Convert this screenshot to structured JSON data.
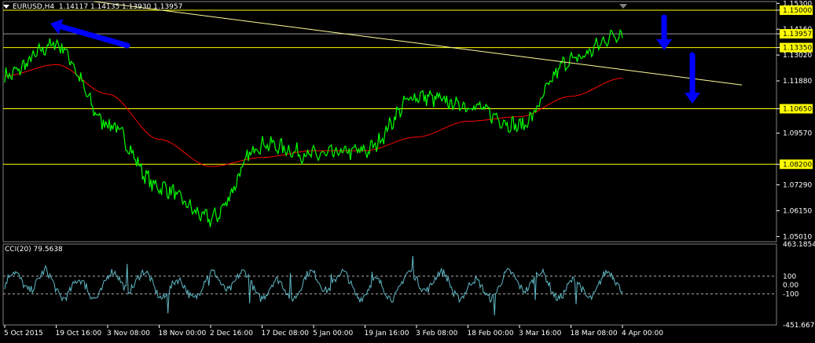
{
  "header": {
    "symbol": "EURUSD,H4",
    "open": "1.14117",
    "high": "1.14135",
    "low": "1.13930",
    "close": "1.13957"
  },
  "colors": {
    "background": "#000000",
    "price": "#00ff00",
    "ma": "#ff0000",
    "level": "#ffff00",
    "trendline": "#ffff99",
    "cci": "#5fb7c4",
    "arrow": "#0000ff",
    "axis_text": "#ffffff"
  },
  "chart_data": [
    {
      "type": "line",
      "symbol": "EURUSD",
      "timeframe": "H4",
      "series": [
        {
          "x": [
            "5 Oct 2015",
            "19 Oct 16:00",
            "3 Nov 08:00",
            "18 Nov 00:00",
            "2 Dec 16:00",
            "17 Dec 08:00",
            "5 Jan 00:00",
            "19 Jan 16:00",
            "3 Feb 08:00",
            "18 Feb 00:00",
            "3 Mar 16:00",
            "18 Mar 08:00",
            "4 Apr 00:00"
          ],
          "values": [
            1.121,
            1.135,
            1.1,
            1.072,
            1.058,
            1.091,
            1.086,
            1.088,
            1.112,
            1.108,
            1.099,
            1.128,
            1.14
          ]
        },
        {
          "values": [
            1.121,
            1.126,
            1.113,
            1.093,
            1.081,
            1.085,
            1.088,
            1.088,
            1.094,
            1.101,
            1.103,
            1.112,
            1.12
          ]
        }
      ],
      "y_ticks": [
        "1.15300",
        "1.15000",
        "1.14160",
        "1.13957",
        "1.13350",
        "1.13020",
        "1.11880",
        "1.10650",
        "1.09570",
        "1.08200",
        "1.07290",
        "1.06150",
        "1.05010"
      ],
      "highlighted_ticks": [
        "1.15000",
        "1.13957",
        "1.13350",
        "1.10650",
        "1.08200"
      ],
      "horizontal_levels": [
        1.15,
        1.1335,
        1.1065,
        1.082
      ],
      "current_price": 1.13957,
      "ylim": [
        1.0478,
        1.1538
      ],
      "x_ticks": [
        "5 Oct 2015",
        "19 Oct 16:00",
        "3 Nov 08:00",
        "18 Nov 00:00",
        "2 Dec 16:00",
        "17 Dec 08:00",
        "5 Jan 00:00",
        "19 Jan 16:00",
        "3 Feb 08:00",
        "18 Feb 00:00",
        "3 Mar 16:00",
        "18 Mar 08:00",
        "4 Apr 00:00"
      ],
      "grid": false
    },
    {
      "type": "line",
      "indicator": "CCI(20)",
      "title": "CCI(20) 79.5638",
      "value": 79.5638,
      "y_ticks": [
        "463.1854",
        "100",
        "0.00",
        "-100",
        "-451.6675"
      ],
      "levels": [
        100,
        -100
      ],
      "ylim": [
        -451.6675,
        463.1854
      ]
    }
  ]
}
